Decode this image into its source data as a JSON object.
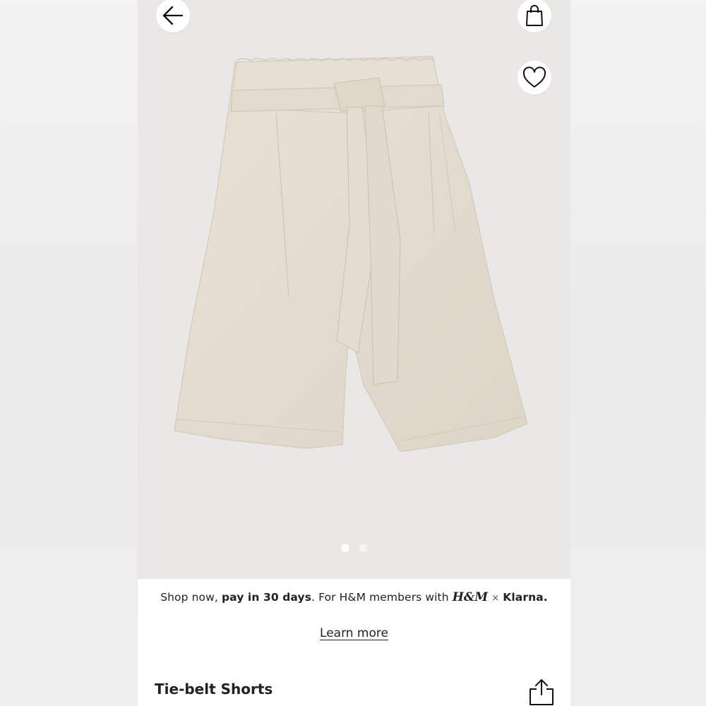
{
  "navigation": {
    "back_icon": "arrow-left-icon",
    "bag_icon": "shopping-bag-icon",
    "favorite_icon": "heart-icon"
  },
  "gallery": {
    "image_alt": "Tie-belt Shorts product photo",
    "page_count": 2,
    "current_page": 1
  },
  "promo": {
    "text_before": "Shop now, ",
    "bold_text": "pay in 30 days",
    "text_after": ". For H&M members with ",
    "hm_logo": "H&M",
    "times_sign": "×",
    "klarna": "Klarna.",
    "learn_more": "Learn more"
  },
  "product": {
    "title": "Tie-belt Shorts",
    "share_icon": "share-icon"
  },
  "colors": {
    "product_fabric": "#e4ddd0",
    "hero_bg": "#e9e8e6"
  }
}
